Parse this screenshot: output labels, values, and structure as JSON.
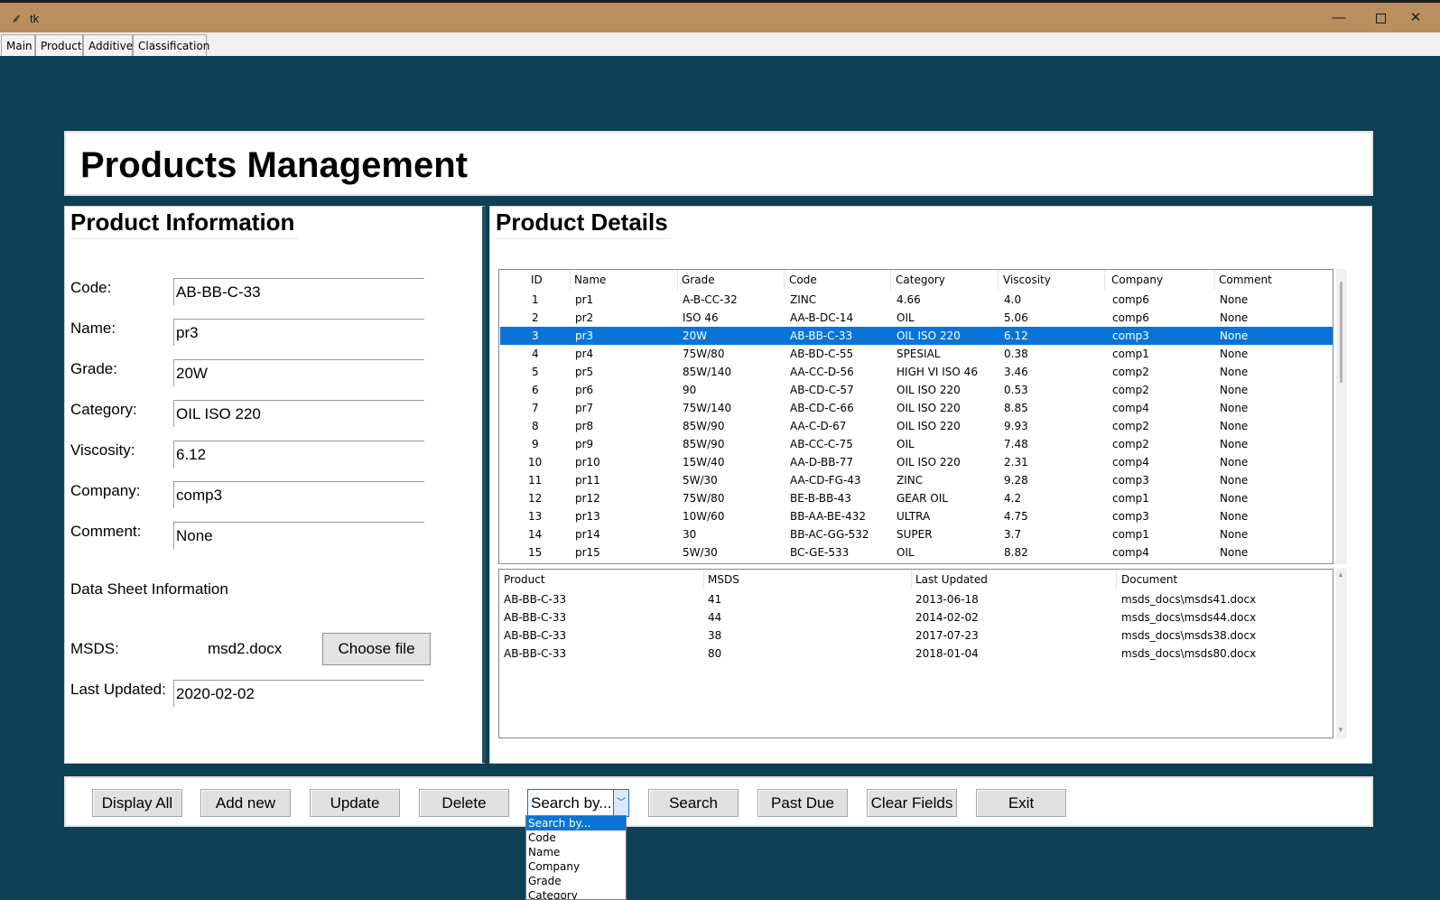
{
  "window": {
    "title": "tk",
    "controls": {
      "minimize": "—",
      "close": "✕"
    }
  },
  "tabs": [
    "Main",
    "Product",
    "Additive",
    "Classification"
  ],
  "header": {
    "title": "Products Management"
  },
  "product_info": {
    "heading": "Product Information",
    "fields": [
      {
        "label": "Code:",
        "value": "AB-BB-C-33"
      },
      {
        "label": "Name:",
        "value": "pr3"
      },
      {
        "label": "Grade:",
        "value": "20W"
      },
      {
        "label": "Category:",
        "value": "OIL ISO 220"
      },
      {
        "label": "Viscosity:",
        "value": "6.12"
      },
      {
        "label": "Company:",
        "value": "comp3"
      },
      {
        "label": "Comment:",
        "value": "None"
      }
    ],
    "datasheet_heading": "Data Sheet Information",
    "msds_label": "MSDS:",
    "msds_value": "msd2.docx",
    "choose_file": "Choose file",
    "last_updated_label": "Last Updated:",
    "last_updated_value": "2020-02-02"
  },
  "product_details": {
    "heading": "Product Details",
    "columns": [
      "ID",
      "Name",
      "Grade",
      "Code",
      "Category",
      "Viscosity",
      "Company",
      "Comment"
    ],
    "rows": [
      [
        "1",
        "pr1",
        "A-B-CC-32",
        "ZINC",
        "4.66",
        "4.0",
        "comp6",
        "None"
      ],
      [
        "2",
        "pr2",
        "ISO 46",
        "AA-B-DC-14",
        "OIL",
        "5.06",
        "comp6",
        "None"
      ],
      [
        "3",
        "pr3",
        "20W",
        "AB-BB-C-33",
        "OIL ISO 220",
        "6.12",
        "comp3",
        "None"
      ],
      [
        "4",
        "pr4",
        "75W/80",
        "AB-BD-C-55",
        "SPESIAL",
        "0.38",
        "comp1",
        "None"
      ],
      [
        "5",
        "pr5",
        "85W/140",
        "AA-CC-D-56",
        "HIGH VI  ISO 46",
        "3.46",
        "comp2",
        "None"
      ],
      [
        "6",
        "pr6",
        "90",
        "AB-CD-C-57",
        "OIL ISO 220",
        "0.53",
        "comp2",
        "None"
      ],
      [
        "7",
        "pr7",
        "75W/140",
        "AB-CD-C-66",
        "OIL ISO 220",
        "8.85",
        "comp4",
        "None"
      ],
      [
        "8",
        "pr8",
        "85W/90",
        "AA-C-D-67",
        "OIL ISO 220",
        "9.93",
        "comp2",
        "None"
      ],
      [
        "9",
        "pr9",
        "85W/90",
        "AB-CC-C-75",
        "OIL",
        "7.48",
        "comp2",
        "None"
      ],
      [
        "10",
        "pr10",
        "15W/40",
        "AA-D-BB-77",
        "OIL ISO 220",
        "2.31",
        "comp4",
        "None"
      ],
      [
        "11",
        "pr11",
        "5W/30",
        "AA-CD-FG-43",
        "ZINC",
        "9.28",
        "comp3",
        "None"
      ],
      [
        "12",
        "pr12",
        "75W/80",
        "BE-B-BB-43",
        "GEAR OIL",
        "4.2",
        "comp1",
        "None"
      ],
      [
        "13",
        "pr13",
        "10W/60",
        "BB-AA-BE-432",
        "ULTRA",
        "4.75",
        "comp3",
        "None"
      ],
      [
        "14",
        "pr14",
        "30",
        "BB-AC-GG-532",
        "SUPER",
        "3.7",
        "comp1",
        "None"
      ],
      [
        "15",
        "pr15",
        "5W/30",
        "BC-GE-533",
        "OIL",
        "8.82",
        "comp4",
        "None"
      ]
    ],
    "selected_row": 2
  },
  "datasheets": {
    "columns": [
      "Product",
      "MSDS",
      "Last Updated",
      "Document"
    ],
    "rows": [
      [
        "AB-BB-C-33",
        "41",
        "2013-06-18",
        "msds_docs\\msds41.docx"
      ],
      [
        "AB-BB-C-33",
        "44",
        "2014-02-02",
        "msds_docs\\msds44.docx"
      ],
      [
        "AB-BB-C-33",
        "38",
        "2017-07-23",
        "msds_docs\\msds38.docx"
      ],
      [
        "AB-BB-C-33",
        "80",
        "2018-01-04",
        "msds_docs\\msds80.docx"
      ]
    ]
  },
  "toolbar": {
    "display_all": "Display All",
    "add_new": "Add new",
    "update": "Update",
    "delete": "Delete",
    "search_combo": "Search by...",
    "search": "Search",
    "past_due": "Past Due",
    "clear_fields": "Clear Fields",
    "exit": "Exit"
  },
  "search_options": [
    "Search by...",
    "Code",
    "Name",
    "Company",
    "Grade",
    "Category"
  ],
  "colors": {
    "background": "#0d4054",
    "titlebar": "#b98f60",
    "selection": "#0a74d6"
  }
}
